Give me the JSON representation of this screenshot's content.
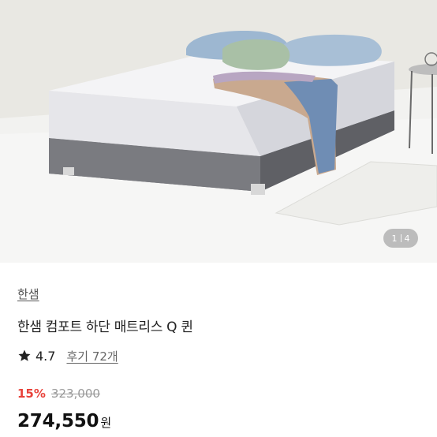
{
  "image": {
    "alt_icon": "bed-mattress-photo",
    "counter_current": "1",
    "counter_total": "4"
  },
  "product": {
    "brand": "한샘",
    "title": "한샘 컴포트 하단 매트리스 Q 퀸",
    "rating": "4.7",
    "review_text": "후기 72개",
    "discount": "15%",
    "original_price": "323,000",
    "sale_price": "274,550",
    "currency": "원"
  },
  "colors": {
    "discount": "#e8423a",
    "text_primary": "#222222",
    "text_muted": "#9a9a9a"
  }
}
